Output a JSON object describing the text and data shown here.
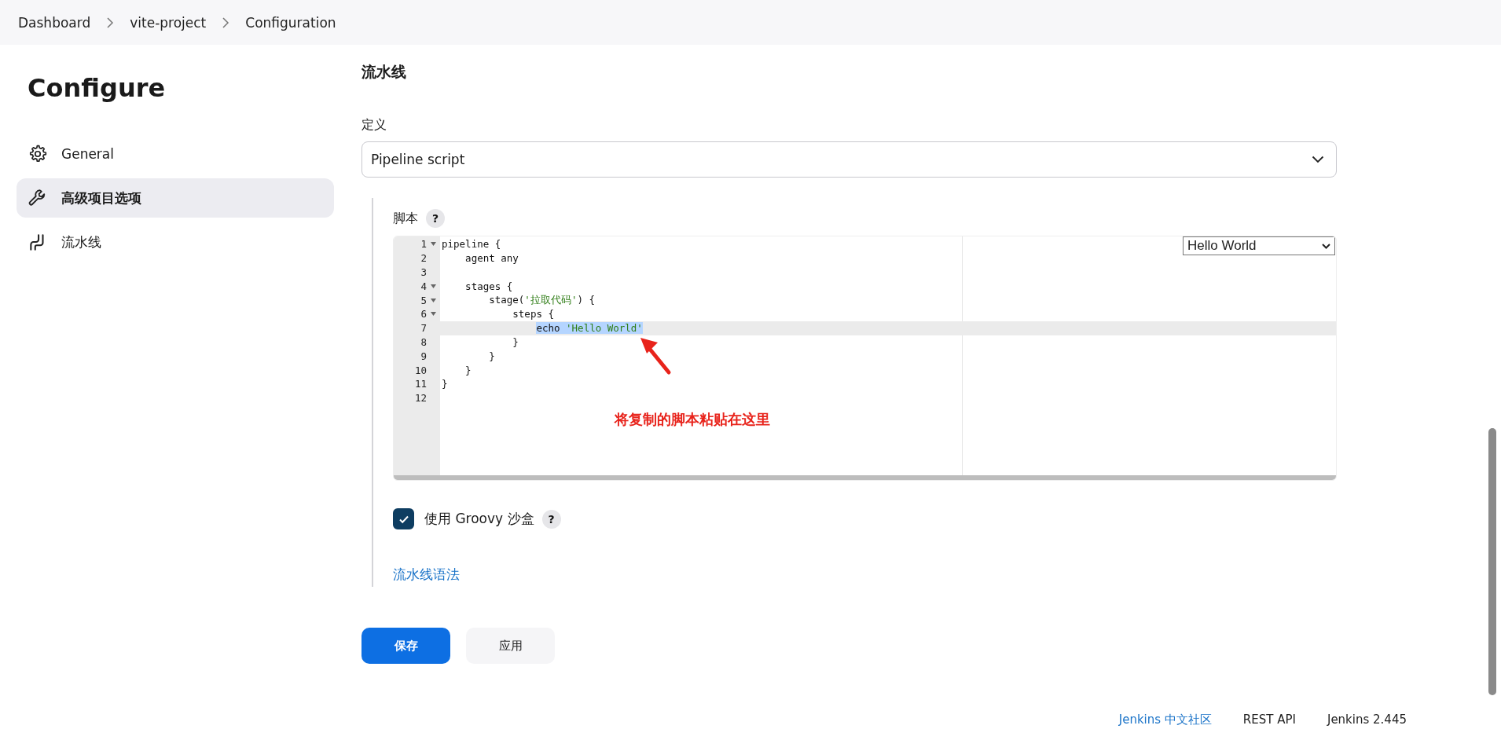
{
  "breadcrumbs": [
    "Dashboard",
    "vite-project",
    "Configuration"
  ],
  "sidebar": {
    "title": "Configure",
    "items": [
      {
        "label": "General",
        "kind": "gear",
        "selected": false
      },
      {
        "label": "高级项目选项",
        "kind": "wrench",
        "selected": true
      },
      {
        "label": "流水线",
        "kind": "pipeline",
        "selected": false
      }
    ]
  },
  "section": {
    "title": "流水线",
    "definition_label": "定义",
    "definition": {
      "value": "Pipeline script"
    },
    "script_label": "脚本",
    "script_help": "?",
    "sample_select": {
      "value": "Hello World"
    },
    "code_lines": [
      {
        "number": "1",
        "fold": true,
        "active": false,
        "tokens": [
          {
            "text": "pipeline {",
            "kind": "plain",
            "selected": false
          }
        ]
      },
      {
        "number": "2",
        "fold": false,
        "active": false,
        "tokens": [
          {
            "text": "    agent any",
            "kind": "plain",
            "selected": false
          }
        ]
      },
      {
        "number": "3",
        "fold": false,
        "active": false
      },
      {
        "number": "4",
        "fold": true,
        "active": false,
        "tokens": [
          {
            "text": "    stages {",
            "kind": "plain",
            "selected": false
          }
        ]
      },
      {
        "number": "5",
        "fold": true,
        "active": false,
        "tokens": [
          {
            "text": "        stage(",
            "kind": "plain",
            "selected": false
          },
          {
            "text": "'拉取代码'",
            "kind": "string",
            "selected": false
          },
          {
            "text": ") {",
            "kind": "plain",
            "selected": false
          }
        ]
      },
      {
        "number": "6",
        "fold": true,
        "active": false,
        "tokens": [
          {
            "text": "            steps {",
            "kind": "plain",
            "selected": false
          }
        ]
      },
      {
        "number": "7",
        "fold": false,
        "active": true,
        "tokens": [
          {
            "text": "                echo ",
            "kind": "plain",
            "selected": true
          },
          {
            "text": "'Hello World'",
            "kind": "string",
            "selected": true
          }
        ]
      },
      {
        "number": "8",
        "fold": false,
        "active": false,
        "tokens": [
          {
            "text": "            }",
            "kind": "plain",
            "selected": false
          }
        ]
      },
      {
        "number": "9",
        "fold": false,
        "active": false,
        "tokens": [
          {
            "text": "        }",
            "kind": "plain",
            "selected": false
          }
        ]
      },
      {
        "number": "10",
        "fold": false,
        "active": false,
        "tokens": [
          {
            "text": "    }",
            "kind": "plain",
            "selected": false
          }
        ]
      },
      {
        "number": "11",
        "fold": false,
        "active": false,
        "tokens": [
          {
            "text": "}",
            "kind": "plain",
            "selected": false
          }
        ]
      },
      {
        "number": "12",
        "fold": false,
        "active": false
      }
    ],
    "annotation": "将复制的脚本粘贴在这里",
    "sandbox": {
      "label": "使用 Groovy 沙盒",
      "checked": true,
      "help": "?"
    },
    "syntax_link": "流水线语法"
  },
  "buttons": [
    {
      "label": "保存",
      "kind": "primary"
    },
    {
      "label": "应用",
      "kind": "secondary"
    }
  ],
  "footer": {
    "community_link": "Jenkins 中文社区",
    "api_link": "REST API",
    "version": "Jenkins 2.445"
  }
}
